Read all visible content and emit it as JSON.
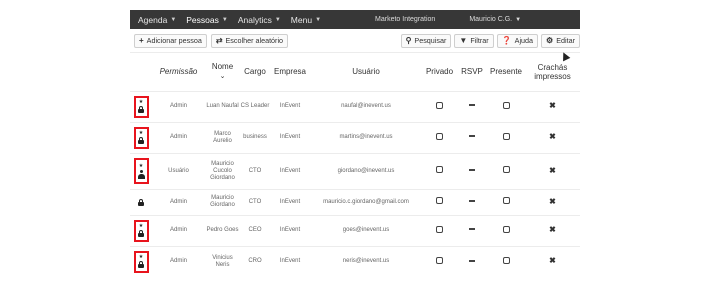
{
  "nav": {
    "items": [
      {
        "label": "Agenda",
        "name": "nav-agenda"
      },
      {
        "label": "Pessoas",
        "name": "nav-pessoas"
      },
      {
        "label": "Analytics",
        "name": "nav-analytics"
      },
      {
        "label": "Menu",
        "name": "nav-menu"
      }
    ],
    "event": "Marketo Integration",
    "user": "Mauricio C.G."
  },
  "toolbar": {
    "add_label": "Adicionar pessoa",
    "random_label": "Escolher aleatório",
    "search_label": "Pesquisar",
    "filter_label": "Filtrar",
    "help_label": "Ajuda",
    "edit_label": "Editar"
  },
  "table": {
    "headers": {
      "permission": "Permissão",
      "name": "Nome",
      "role": "Cargo",
      "company": "Empresa",
      "user": "Usuário",
      "private": "Privado",
      "rsvp": "RSVP",
      "present": "Presente",
      "badges": "Crachás impressos"
    },
    "rows": [
      {
        "permission": "Admin",
        "name": "Luan Naufal",
        "role": "CS Leader",
        "company": "InEvent",
        "user": "naufal@inevent.us"
      },
      {
        "permission": "Admin",
        "name": "Marco Aurelio",
        "role": "business",
        "company": "InEvent",
        "user": "martins@inevent.us"
      },
      {
        "permission": "Usuário",
        "name": "Mauricio Cucolo Giordano",
        "role": "CTO",
        "company": "InEvent",
        "user": "giordano@inevent.us"
      },
      {
        "permission": "Admin",
        "name": "Mauricio Giordano",
        "role": "CTO",
        "company": "InEvent",
        "user": "mauricio.c.giordano@gmail.com"
      },
      {
        "permission": "Admin",
        "name": "Pedro Goes",
        "role": "CEO",
        "company": "InEvent",
        "user": "goes@inevent.us"
      },
      {
        "permission": "Admin",
        "name": "Vinicius Neris",
        "role": "CRO",
        "company": "InEvent",
        "user": "neris@inevent.us"
      }
    ]
  },
  "colors": {
    "nav_bg": "#373737",
    "highlight": "#e8141d"
  }
}
